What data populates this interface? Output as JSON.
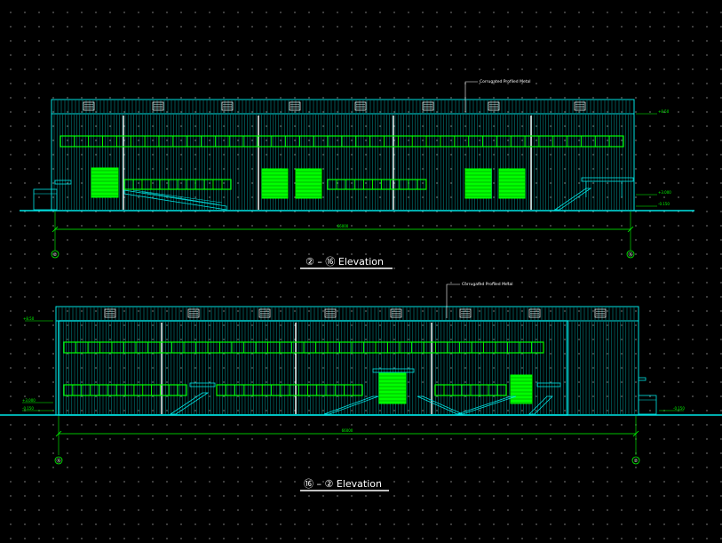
{
  "drawing": {
    "background_color": "#000000",
    "wall_color": "#00e5e5",
    "window_color": "#00ff00",
    "door_color": "#00ff00",
    "dimension_color": "#00ff00",
    "text_color": "#ffffff"
  },
  "elevation_top": {
    "title": "② – ⑯ Elevation",
    "material_note": "Corrugated Profiled Metal",
    "overall_dimension": "66000",
    "grid_left": "②",
    "grid_right": "⑯",
    "levels": [
      "+8.50",
      "+3.000",
      "+0.00",
      "-0.150"
    ]
  },
  "elevation_bottom": {
    "title": "⑯ – ② Elevation",
    "material_note": "Corrugated Profiled Metal",
    "overall_dimension": "66000",
    "grid_left": "⑯",
    "grid_right": "②",
    "levels": [
      "+8.50",
      "+3.000",
      "+0.00",
      "-0.150"
    ]
  }
}
